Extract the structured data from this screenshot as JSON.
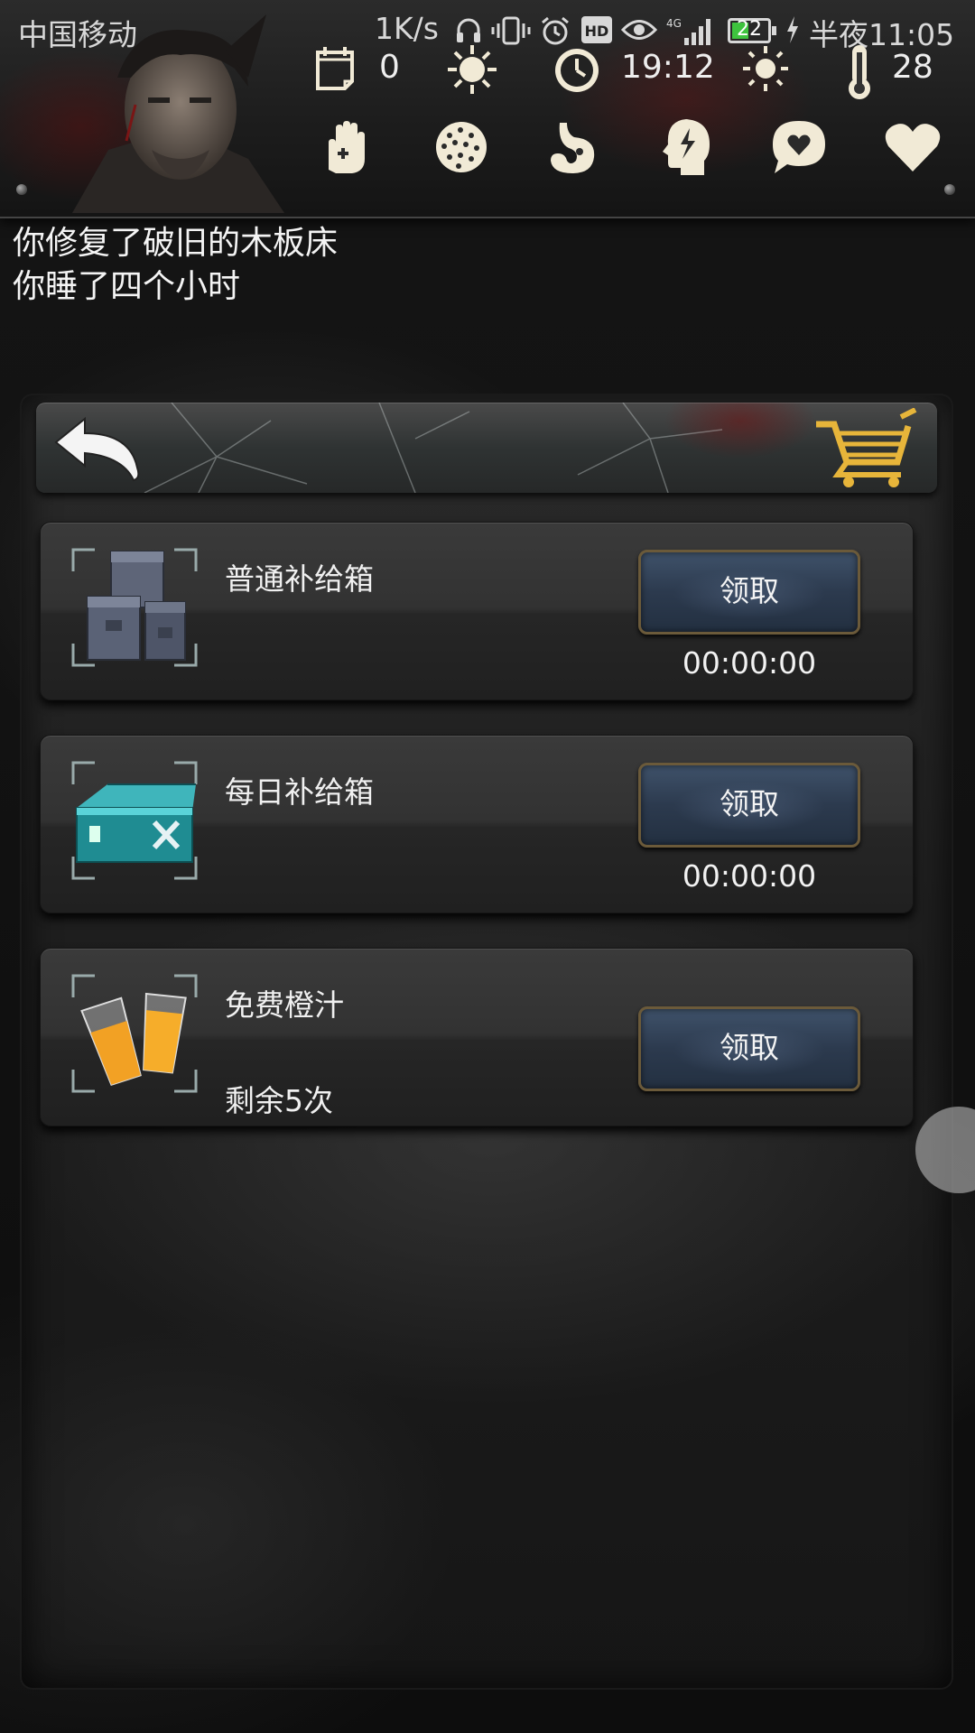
{
  "status_bar": {
    "carrier": "中国移动",
    "net_speed": "1K/s",
    "battery_level": "22",
    "clock": "半夜11:05",
    "icons": [
      "headphones-icon",
      "vibrate-icon",
      "alarm-icon",
      "hd-icon",
      "eye-icon",
      "signal-4g-icon",
      "battery-icon",
      "charging-icon"
    ]
  },
  "header": {
    "stats": {
      "days": "0",
      "time": "19:12",
      "temperature": "28"
    },
    "stat_icons": [
      "calendar-icon",
      "sun-burst-icon",
      "clock-icon",
      "sun-icon",
      "thermometer-icon"
    ],
    "condition_icons": [
      "hand-icon",
      "virus-icon",
      "stomach-icon",
      "head-energy-icon",
      "speech-heart-icon",
      "heart-icon"
    ]
  },
  "log": {
    "lines": [
      "你修复了破旧的木板床",
      "你睡了四个小时"
    ]
  },
  "panel": {
    "items": [
      {
        "title": "普通补给箱",
        "button_label": "领取",
        "timer": "00:00:00",
        "icon": "ammo-crates-icon"
      },
      {
        "title": "每日补给箱",
        "button_label": "领取",
        "timer": "00:00:00",
        "icon": "tool-case-icon"
      },
      {
        "title": "免费橙汁",
        "button_label": "领取",
        "remaining": "剩余5次",
        "icon": "orange-juice-icon"
      }
    ]
  },
  "colors": {
    "button_blue": "#2c3a4e",
    "button_border": "#6b5a3a",
    "battery_green": "#3ec33e",
    "cream_icon": "#f1ead6"
  }
}
